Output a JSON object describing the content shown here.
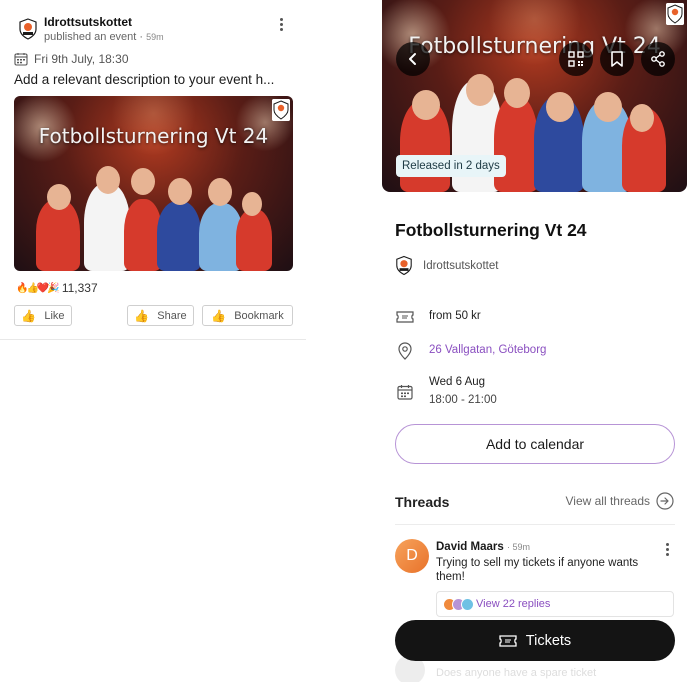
{
  "post": {
    "org_name": "Idrottsutskottet",
    "action": "published an event",
    "time": "59m",
    "date": "Fri 9th July, 18:30",
    "description": "Add a relevant description to your event h...",
    "banner_title": "Fotbollsturnering Vt 24",
    "reaction_emojis": "🔥👍❤️🎉",
    "reaction_count": "11,337",
    "buttons": {
      "like": "Like",
      "share": "Share",
      "bookmark": "Bookmark"
    }
  },
  "event": {
    "banner_title": "Fotbollsturnering Vt 24",
    "released_badge": "Released in 2 days",
    "title": "Fotbollsturnering Vt 24",
    "organizer": "Idrottsutskottet",
    "price": "from 50 kr",
    "address": "26 Vallgatan, Göteborg",
    "date": "Wed 6 Aug",
    "time_range": "18:00 - 21:00",
    "add_to_calendar": "Add to calendar",
    "tickets_label": "Tickets"
  },
  "threads": {
    "heading": "Threads",
    "view_all": "View all threads",
    "items": [
      {
        "avatar_initial": "D",
        "author": "David Maars",
        "time": "59m",
        "body": "Trying to sell my tickets if anyone wants them!",
        "replies": "View 22 replies"
      }
    ],
    "ghost_text": "Does anyone have a spare ticket"
  },
  "colors": {
    "accent_purple": "#8a4fc0",
    "button_dark": "#141414",
    "badge_bg": "#e8f5f8",
    "avatar_orange": "#f08a3c"
  }
}
